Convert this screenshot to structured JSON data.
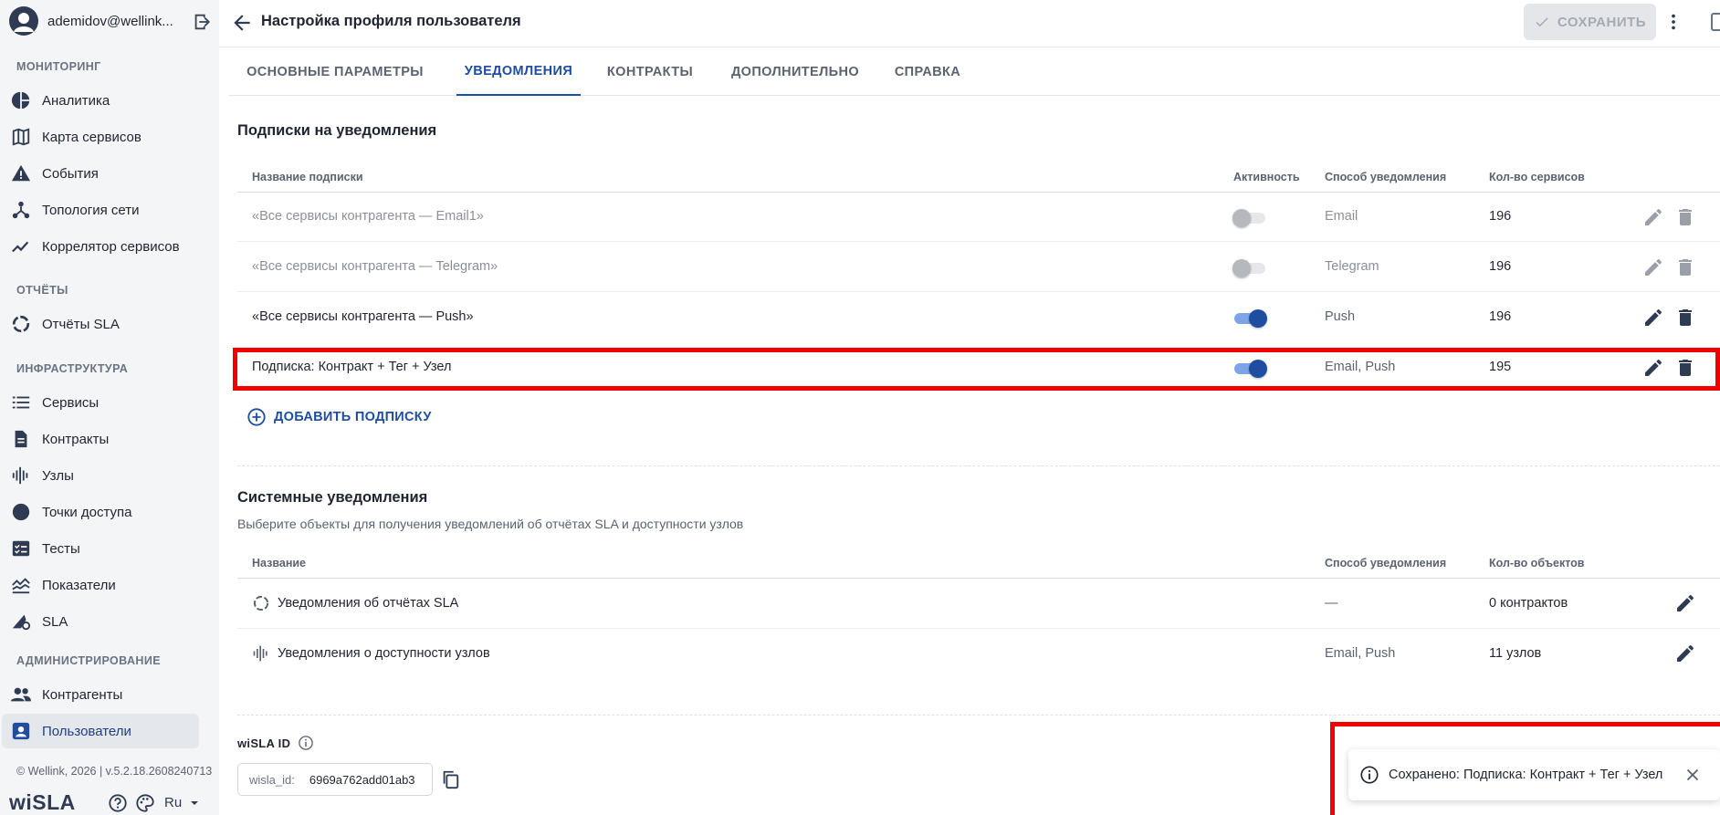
{
  "user": {
    "email": "ademidov@wellink..."
  },
  "sidebar": {
    "sections": [
      {
        "title": "МОНИТОРИНГ",
        "items": [
          {
            "label": "Аналитика",
            "icon": "pie-chart-icon"
          },
          {
            "label": "Карта сервисов",
            "icon": "map-icon"
          },
          {
            "label": "События",
            "icon": "warning-icon"
          },
          {
            "label": "Топология сети",
            "icon": "topology-icon"
          },
          {
            "label": "Коррелятор сервисов",
            "icon": "trend-icon"
          }
        ]
      },
      {
        "title": "ОТЧЁТЫ",
        "items": [
          {
            "label": "Отчёты SLA",
            "icon": "progress-circle-icon"
          }
        ]
      },
      {
        "title": "ИНФРАСТРУКТУРА",
        "items": [
          {
            "label": "Сервисы",
            "icon": "list-icon"
          },
          {
            "label": "Контракты",
            "icon": "document-icon"
          },
          {
            "label": "Узлы",
            "icon": "nodes-icon"
          },
          {
            "label": "Точки доступа",
            "icon": "dot-icon"
          },
          {
            "label": "Тесты",
            "icon": "checklist-icon"
          },
          {
            "label": "Показатели",
            "icon": "metrics-icon"
          },
          {
            "label": "SLA",
            "icon": "sla-icon"
          }
        ]
      },
      {
        "title": "АДМИНИСТРИРОВАНИЕ",
        "items": [
          {
            "label": "Контрагенты",
            "icon": "people-icon"
          },
          {
            "label": "Пользователи",
            "icon": "user-badge-icon",
            "active": true
          }
        ]
      }
    ],
    "footer": "© Wellink, 2026 | v.5.2.18.2608240713",
    "logo": "wiSLA",
    "lang": "Ru"
  },
  "header": {
    "title": "Настройка профиля пользователя",
    "save_label": "СОХРАНИТЬ"
  },
  "tabs": [
    {
      "label": "ОСНОВНЫЕ ПАРАМЕТРЫ",
      "active": false
    },
    {
      "label": "УВЕДОМЛЕНИЯ",
      "active": true
    },
    {
      "label": "КОНТРАКТЫ",
      "active": false
    },
    {
      "label": "ДОПОЛНИТЕЛЬНО",
      "active": false
    },
    {
      "label": "СПРАВКА",
      "active": false
    }
  ],
  "subscriptions": {
    "title": "Подписки на уведомления",
    "columns": {
      "name": "Название подписки",
      "active": "Активность",
      "method": "Способ уведомления",
      "count": "Кол-во сервисов"
    },
    "rows": [
      {
        "name": "«Все сервисы контрагента — Email1»",
        "active": false,
        "method": "Email",
        "count": "196"
      },
      {
        "name": "«Все сервисы контрагента — Telegram»",
        "active": false,
        "method": "Telegram",
        "count": "196"
      },
      {
        "name": "«Все сервисы контрагента — Push»",
        "active": true,
        "method": "Push",
        "count": "196"
      },
      {
        "name": "Подписка: Контракт + Тег + Узел",
        "active": true,
        "method": "Email, Push",
        "count": "195"
      }
    ],
    "add_label": "ДОБАВИТЬ ПОДПИСКУ"
  },
  "system": {
    "title": "Системные уведомления",
    "subtitle": "Выберите объекты для получения уведомлений об отчётах SLA и доступности узлов",
    "columns": {
      "name": "Название",
      "method": "Способ уведомления",
      "count": "Кол-во объектов"
    },
    "rows": [
      {
        "name": "Уведомления об отчётах SLA",
        "method": "—",
        "count": "0 контрактов",
        "icon": "progress-circle-icon"
      },
      {
        "name": "Уведомления о доступности узлов",
        "method": "Email, Push",
        "count": "11 узлов",
        "icon": "nodes-icon"
      }
    ]
  },
  "wisla_id": {
    "label": "wiSLA ID",
    "key": "wisla_id:",
    "value": "6969a762add01ab3"
  },
  "toast": {
    "message": "Сохранено: Подписка: Контракт + Тег + Узел"
  },
  "colors": {
    "accent": "#1f4ea0",
    "highlight": "#f20000",
    "sidebar_bg": "#f4f5f7"
  }
}
